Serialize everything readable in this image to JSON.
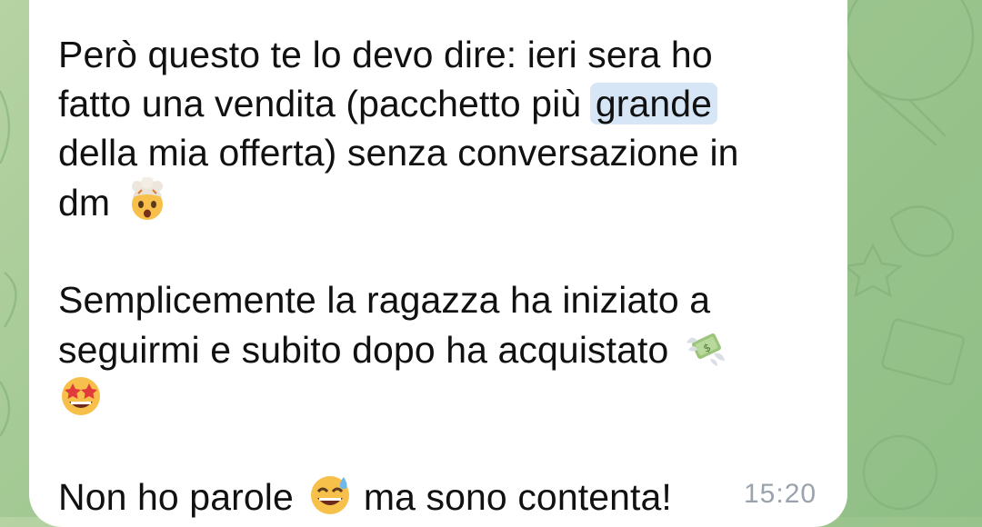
{
  "message": {
    "line1": "Però questo te lo devo dire: ieri sera ho",
    "line2_before": "fatto una vendita (pacchetto più ",
    "line2_highlight": "grande",
    "line3": "della mia offerta) senza conversazione in",
    "line4": "dm",
    "line6": "Semplicemente la ragazza ha iniziato a",
    "line7": "seguirmi e subito dopo ha acquistato",
    "line10_before": "Non ho parole",
    "line10_after": "ma sono contenta!",
    "time": "15:20"
  },
  "emojis": [
    "exploding-head",
    "money-with-wings",
    "star-struck",
    "grinning-sweat"
  ],
  "colors": {
    "bubble": "#ffffff",
    "highlight": "#d6e6f6",
    "timestamp": "#9aa3ad",
    "wallpaper": "#9ec68f"
  }
}
